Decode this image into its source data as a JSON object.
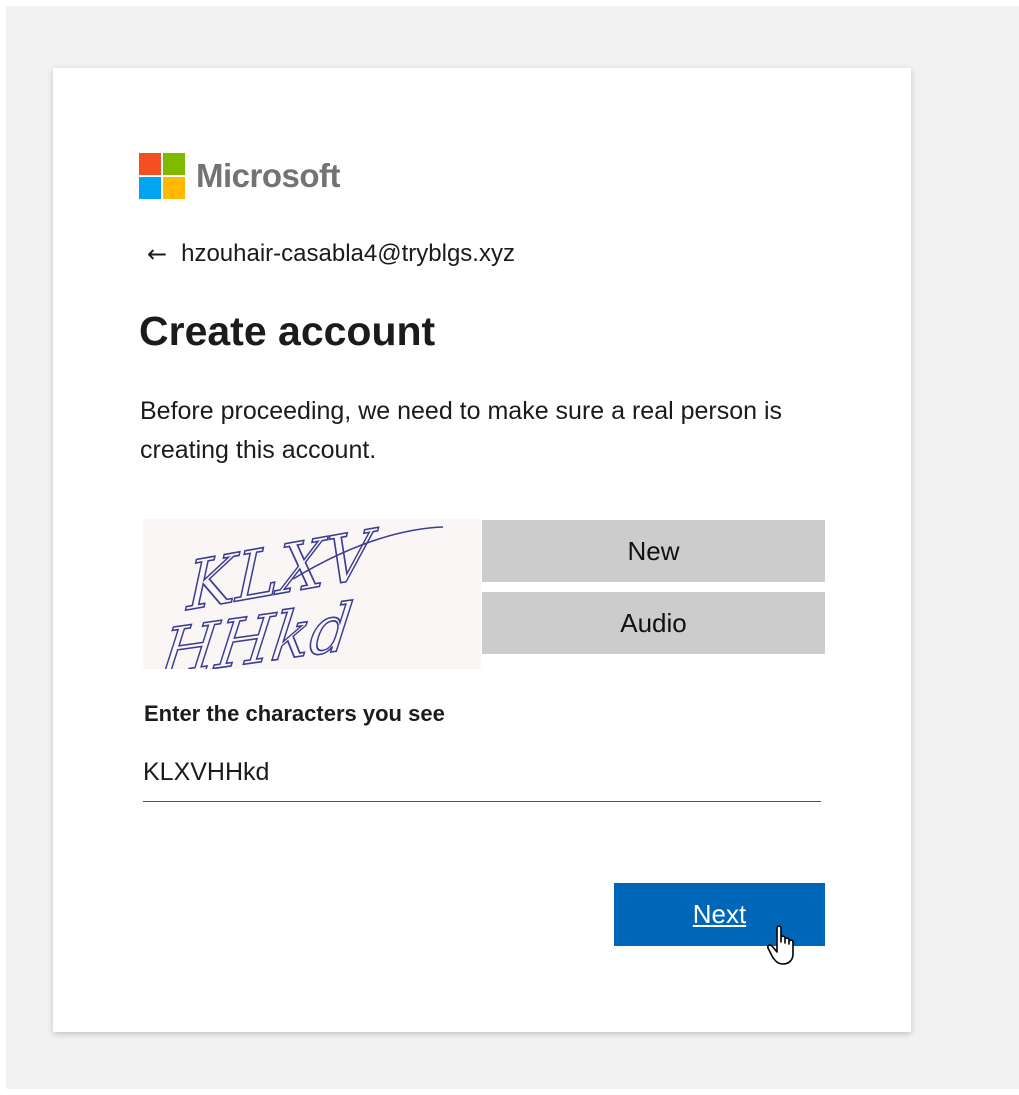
{
  "brand": {
    "name": "Microsoft",
    "logo_colors": [
      "#f25022",
      "#7fba00",
      "#00a4ef",
      "#ffb900"
    ],
    "text_color": "#737373"
  },
  "back": {
    "icon": "arrow-left-icon",
    "email": "hzouhair-casabla4@tryblgs.xyz"
  },
  "page": {
    "title": "Create account",
    "description": "Before proceeding, we need to make sure a real person is creating this account."
  },
  "captcha": {
    "image_text": "KLXV HHkd",
    "new_label": "New",
    "audio_label": "Audio"
  },
  "input": {
    "label": "Enter the characters you see",
    "value": "KLXVHHkd"
  },
  "actions": {
    "next_label": "Next",
    "accent_color": "#0067b8"
  },
  "cursor": {
    "icon": "hand-pointer-icon"
  }
}
